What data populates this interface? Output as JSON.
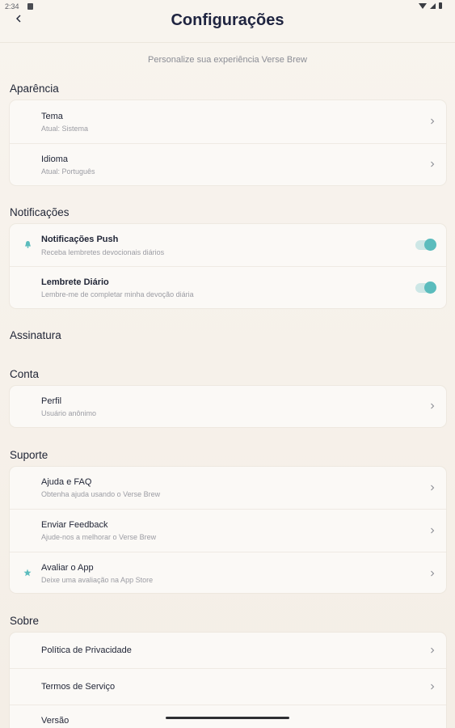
{
  "status": {
    "time": "2:34"
  },
  "header": {
    "title": "Configurações",
    "subtitle": "Personalize sua experiência Verse Brew"
  },
  "sections": {
    "appearance": {
      "title": "Aparência",
      "rows": [
        {
          "title": "Tema",
          "subtitle": "Atual: Sistema"
        },
        {
          "title": "Idioma",
          "subtitle": "Atual: Português"
        }
      ]
    },
    "notifications": {
      "title": "Notificações",
      "rows": [
        {
          "title": "Notificações Push",
          "subtitle": "Receba lembretes devocionais diários",
          "enabled": true
        },
        {
          "title": "Lembrete Diário",
          "subtitle": "Lembre-me de completar minha devoção diária",
          "enabled": true
        }
      ]
    },
    "subscription": {
      "title": "Assinatura"
    },
    "account": {
      "title": "Conta",
      "rows": [
        {
          "title": "Perfil",
          "subtitle": "Usuário anônimo"
        }
      ]
    },
    "support": {
      "title": "Suporte",
      "rows": [
        {
          "title": "Ajuda e FAQ",
          "subtitle": "Obtenha ajuda usando o Verse Brew"
        },
        {
          "title": "Enviar Feedback",
          "subtitle": "Ajude-nos a melhorar o Verse Brew"
        },
        {
          "title": "Avaliar o App",
          "subtitle": "Deixe uma avaliação na App Store"
        }
      ]
    },
    "about": {
      "title": "Sobre",
      "rows": [
        {
          "title": "Política de Privacidade"
        },
        {
          "title": "Termos de Serviço"
        },
        {
          "title": "Versão"
        }
      ]
    }
  },
  "colors": {
    "accent": "#5bbcbd",
    "background": "#f6f1ea",
    "card": "#fbf9f6",
    "text": "#1f2435"
  },
  "icons": {
    "back": "chevron-left-icon",
    "push": "bell-icon",
    "rate": "star-icon",
    "row_arrow": "chevron-right-icon"
  }
}
